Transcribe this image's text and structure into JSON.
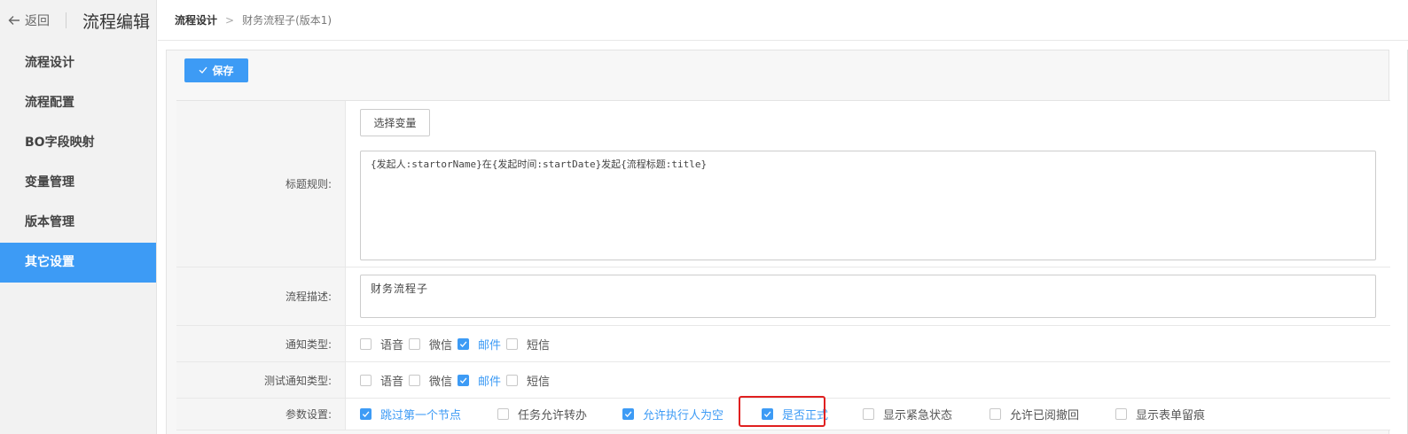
{
  "sidebar": {
    "back_label": "返回",
    "title": "流程编辑",
    "items": [
      {
        "label": "流程设计",
        "active": false
      },
      {
        "label": "流程配置",
        "active": false
      },
      {
        "label": "BO字段映射",
        "active": false
      },
      {
        "label": "变量管理",
        "active": false
      },
      {
        "label": "版本管理",
        "active": false
      },
      {
        "label": "其它设置",
        "active": true
      }
    ]
  },
  "breadcrumb": {
    "root": "流程设计",
    "separator": ">",
    "current": "财务流程子(版本1)"
  },
  "toolbar": {
    "save_label": "保存"
  },
  "form": {
    "title_rule": {
      "label": "标题规则:",
      "select_var_label": "选择变量",
      "value": "{发起人:startorName}在{发起时间:startDate}发起{流程标题:title}"
    },
    "description": {
      "label": "流程描述:",
      "value": "财务流程子"
    },
    "notify_type": {
      "label": "通知类型:",
      "options": [
        {
          "label": "语音",
          "checked": false
        },
        {
          "label": "微信",
          "checked": false
        },
        {
          "label": "邮件",
          "checked": true
        },
        {
          "label": "短信",
          "checked": false
        }
      ]
    },
    "test_notify_type": {
      "label": "测试通知类型:",
      "options": [
        {
          "label": "语音",
          "checked": false
        },
        {
          "label": "微信",
          "checked": false
        },
        {
          "label": "邮件",
          "checked": true
        },
        {
          "label": "短信",
          "checked": false
        }
      ]
    },
    "params": {
      "label": "参数设置:",
      "options": [
        {
          "label": "跳过第一个节点",
          "checked": true
        },
        {
          "label": "任务允许转办",
          "checked": false
        },
        {
          "label": "允许执行人为空",
          "checked": true
        },
        {
          "label": "是否正式",
          "checked": true
        },
        {
          "label": "显示紧急状态",
          "checked": false
        },
        {
          "label": "允许已阅撤回",
          "checked": false
        },
        {
          "label": "显示表单留痕",
          "checked": false
        }
      ]
    }
  },
  "colors": {
    "accent": "#3d9bf5",
    "highlight": "#e02020"
  }
}
